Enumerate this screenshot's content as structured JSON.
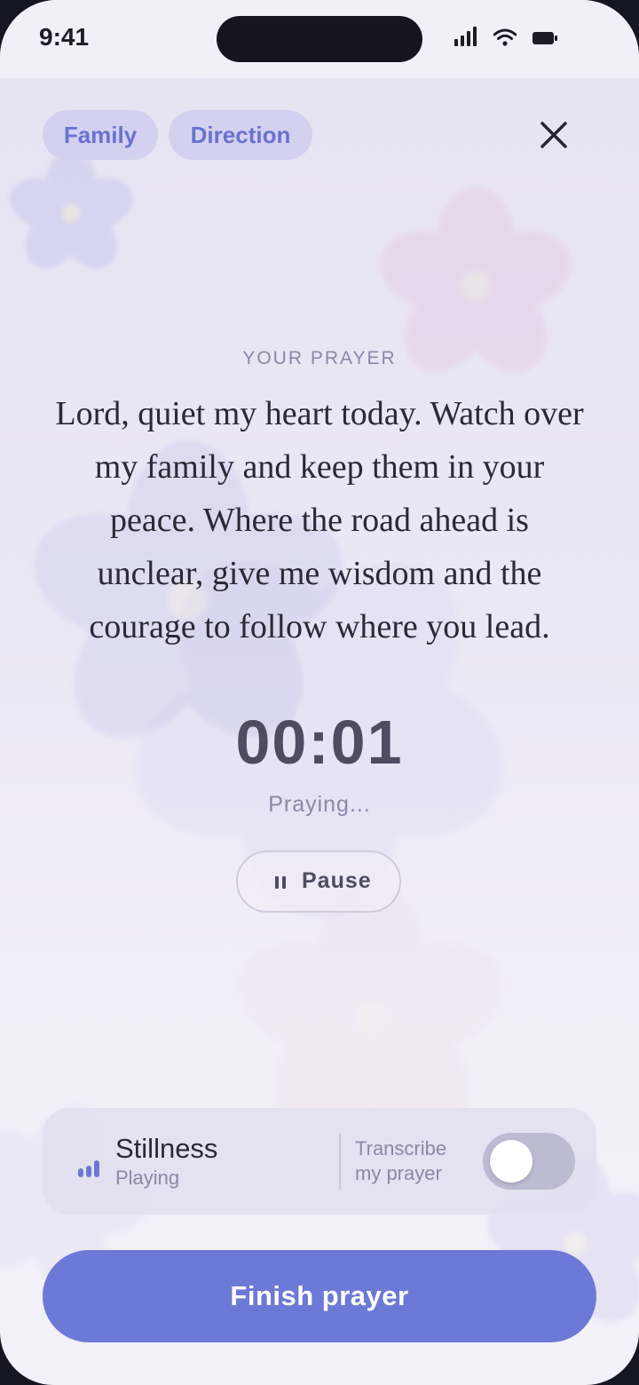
{
  "status_bar": {
    "time": "9:41",
    "icons": [
      "cellular-signal-icon",
      "wifi-icon",
      "battery-icon"
    ]
  },
  "topics": [
    "Family",
    "Direction"
  ],
  "close_icon": "close-icon",
  "prayer": {
    "eyebrow": "YOUR PRAYER",
    "text": "Lord, quiet my heart today. Watch over my family and keep them in your peace. Where the road ahead is unclear, give me wisdom and the courage to follow where you lead."
  },
  "session": {
    "timer": "00:01",
    "status": "Praying...",
    "pause_label": "Pause",
    "pause_icon": "pause-icon"
  },
  "audio": {
    "track_name": "Stillness",
    "track_state": "Playing",
    "equalizer_icon": "equalizer-icon"
  },
  "transcribe": {
    "label_line1": "Transcribe",
    "label_line2": "my prayer",
    "enabled": false
  },
  "finish_label": "Finish prayer",
  "colors": {
    "accent": "#6d79d6",
    "chip_bg": "#d3d1ef",
    "chip_text": "#6a72cf",
    "background": "#ebe8f5"
  }
}
